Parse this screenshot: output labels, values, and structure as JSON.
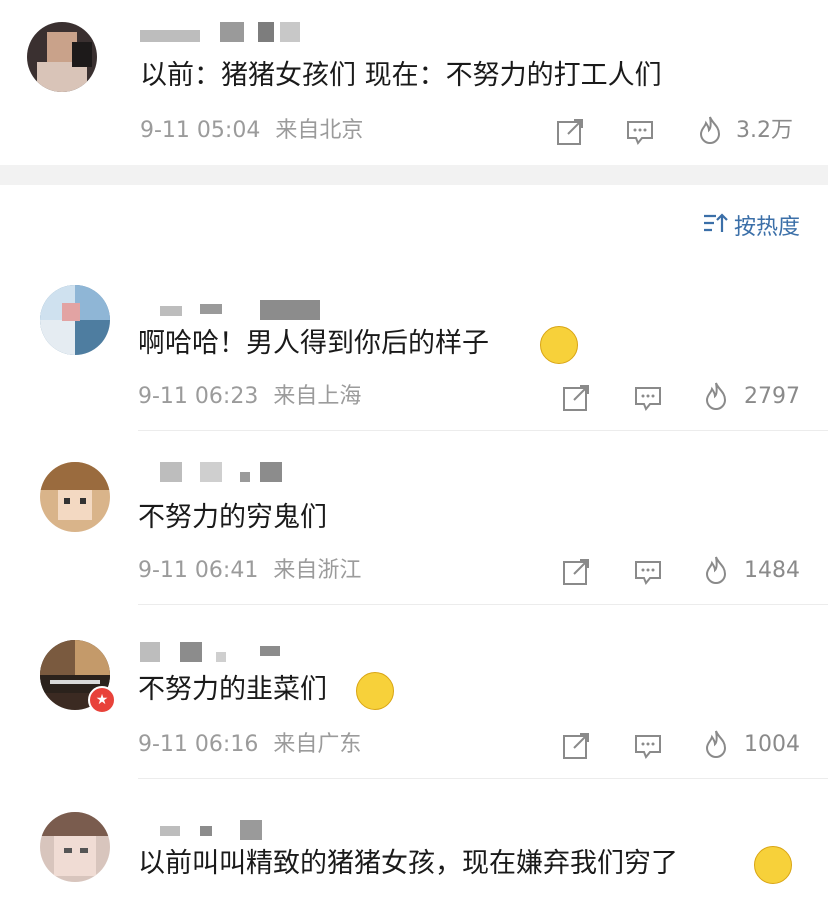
{
  "post": {
    "text": "以前：猪猪女孩们 现在：不努力的打工人们",
    "time": "9-11 05:04",
    "location": "来自北京",
    "likes": "3.2万"
  },
  "sort": {
    "label": "按热度",
    "icon": "sort-icon"
  },
  "comments": [
    {
      "text": "啊哈哈！男人得到你后的样子",
      "time": "9-11 06:23",
      "location": "来自上海",
      "likes": "2797",
      "emoji": "smirk-emoji"
    },
    {
      "text": "不努力的穷鬼们",
      "time": "9-11 06:41",
      "location": "来自浙江",
      "likes": "1484"
    },
    {
      "text": "不努力的韭菜们",
      "time": "9-11 06:16",
      "location": "来自广东",
      "likes": "1004",
      "emoji": "laughing-emoji"
    },
    {
      "text": "以前叫叫精致的猪猪女孩，现在嫌弃我们穷了",
      "emoji": "crying-laughing-emoji"
    }
  ],
  "icons": {
    "share": "share-icon",
    "comment": "comment-icon",
    "like": "flame-icon"
  },
  "colors": {
    "link": "#3b6fa8",
    "meta": "#9b9b9b",
    "divider": "#ececec",
    "band": "#f2f2f2"
  }
}
